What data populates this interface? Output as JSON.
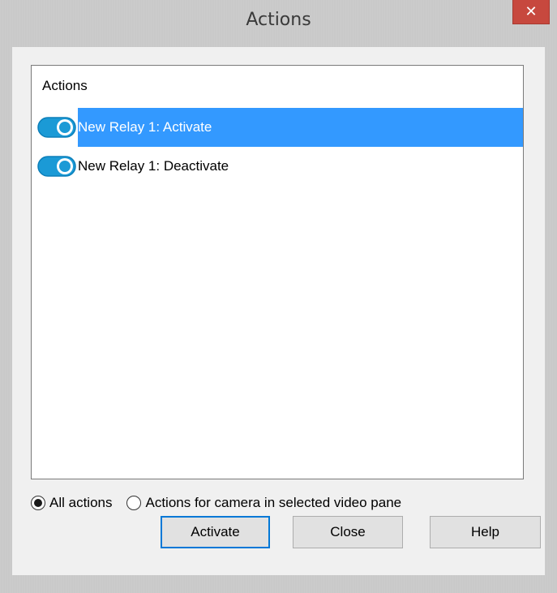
{
  "window": {
    "title": "Actions",
    "close_glyph": "✕"
  },
  "list": {
    "header": "Actions",
    "items": [
      {
        "label": "New Relay 1: Activate",
        "selected": true,
        "icon": "toggle-on-icon"
      },
      {
        "label": "New Relay 1: Deactivate",
        "selected": false,
        "icon": "toggle-on-icon"
      }
    ]
  },
  "filter": {
    "options": [
      {
        "label": "All actions",
        "checked": true
      },
      {
        "label": "Actions for camera in selected video pane",
        "checked": false
      }
    ]
  },
  "buttons": {
    "activate": "Activate",
    "close": "Close",
    "help": "Help"
  },
  "colors": {
    "selection": "#3399ff",
    "toggle": "#1b9ad6",
    "close_button": "#c7483e"
  }
}
